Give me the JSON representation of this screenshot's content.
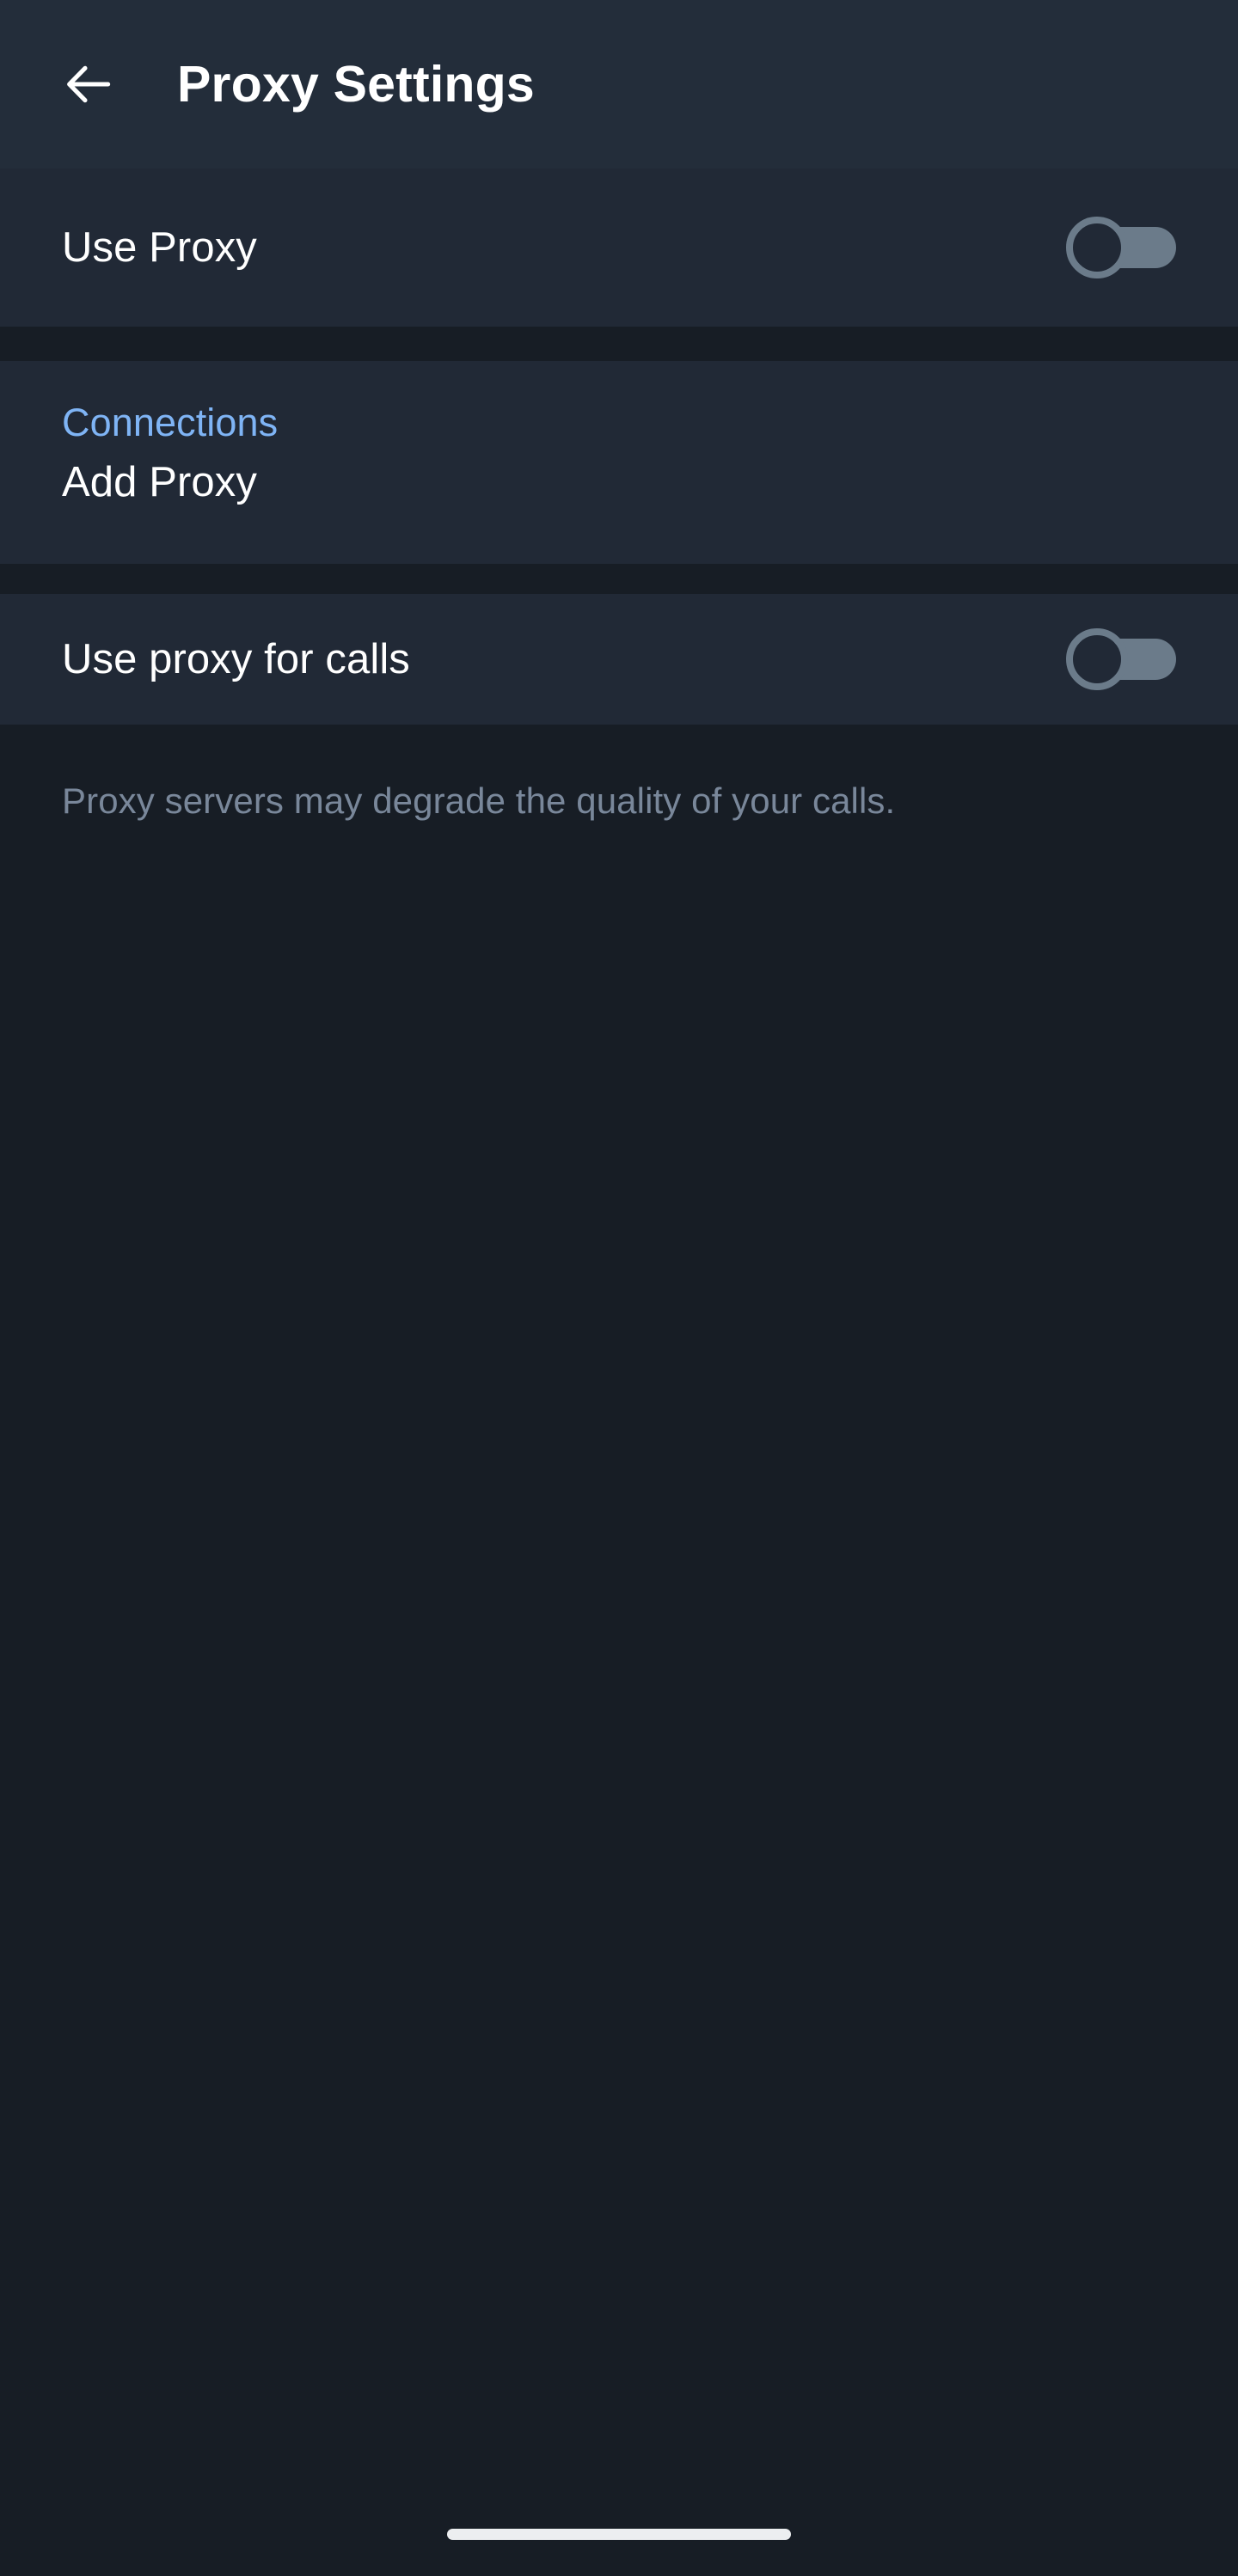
{
  "header": {
    "title": "Proxy Settings",
    "back_icon": "arrow-left-icon"
  },
  "sections": [
    {
      "id": "use-proxy",
      "rows": [
        {
          "id": "use-proxy",
          "label": "Use Proxy",
          "control": "toggle",
          "toggle_state": "off"
        }
      ]
    },
    {
      "id": "connections",
      "header": "Connections",
      "rows": [
        {
          "id": "add-proxy",
          "label": "Add Proxy",
          "control": "none"
        }
      ]
    },
    {
      "id": "calls",
      "rows": [
        {
          "id": "use-proxy-for-calls",
          "label": "Use proxy for calls",
          "control": "toggle",
          "toggle_state": "off"
        }
      ]
    }
  ],
  "footnote": "Proxy servers may degrade the quality of your calls.",
  "colors": {
    "header_bg": "#232d3a",
    "section_bg": "#212936",
    "page_bg": "#171d25",
    "primary_text": "#ffffff",
    "accent_blue": "#7fb4f5",
    "muted_text": "#79879a",
    "toggle_track_off": "#6b7b8a",
    "home_indicator": "#eceef0"
  },
  "system": {
    "home_indicator": "home-indicator"
  }
}
